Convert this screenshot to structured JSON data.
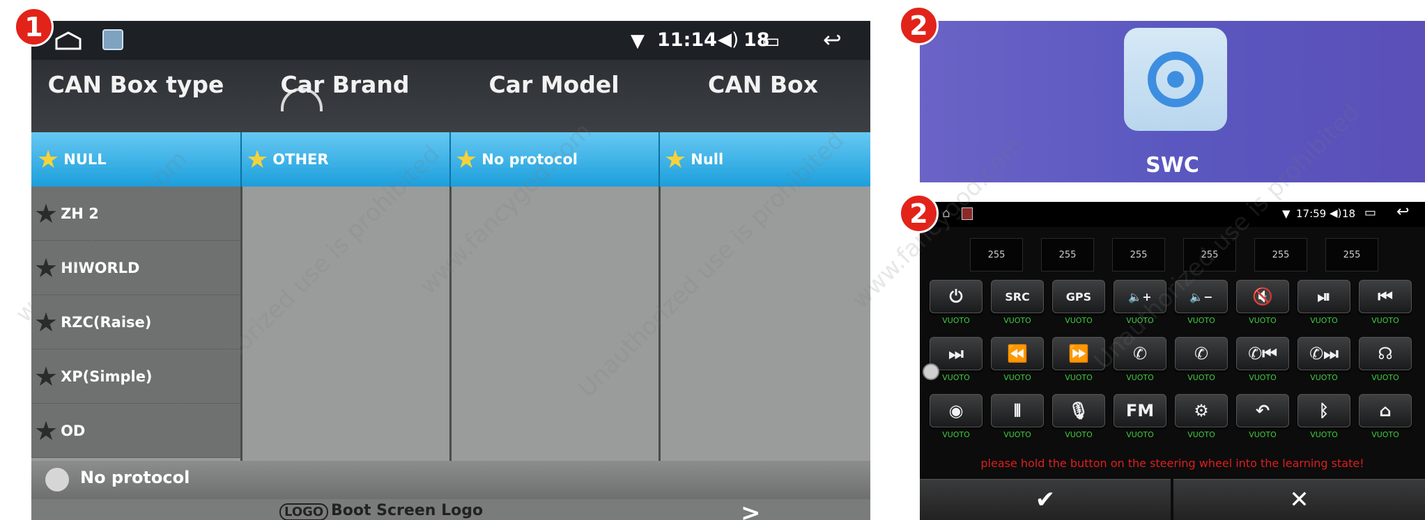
{
  "panel1": {
    "badge": "1",
    "status": {
      "time": "11:14",
      "volume": "18"
    },
    "columns": [
      "CAN Box type",
      "Car Brand",
      "Car Model",
      "CAN Box"
    ],
    "selected_row": [
      "NULL",
      "OTHER",
      "No protocol",
      "Null"
    ],
    "can_box_types": [
      "ZH 2",
      "HIWORLD",
      "RZC(Raise)",
      "XP(Simple)",
      "OD"
    ],
    "bottom_label": "No protocol",
    "boot_logo_badge": "LOGO",
    "boot_logo_label": "Boot Screen Logo",
    "boot_chevron": ">"
  },
  "panel2a": {
    "badge": "2",
    "app_label": "SWC"
  },
  "panel2b": {
    "badge": "2",
    "status": {
      "time": "17:59",
      "volume": "18"
    },
    "values": [
      "255",
      "255",
      "255",
      "255",
      "255",
      "255"
    ],
    "key_rows": [
      [
        {
          "glyph": "⏻",
          "icon": "power-icon",
          "label": "VUOTO"
        },
        {
          "glyph": "SRC",
          "icon": "src-icon",
          "label": "VUOTO"
        },
        {
          "glyph": "GPS",
          "icon": "gps-icon",
          "label": "VUOTO"
        },
        {
          "glyph": "🔈+",
          "icon": "volume-up-icon",
          "label": "VUOTO"
        },
        {
          "glyph": "🔈−",
          "icon": "volume-down-icon",
          "label": "VUOTO"
        },
        {
          "glyph": "🔇",
          "icon": "mute-icon",
          "label": "VUOTO"
        },
        {
          "glyph": "⏯",
          "icon": "play-pause-icon",
          "label": "VUOTO"
        },
        {
          "glyph": "⏮",
          "icon": "previous-icon",
          "label": "VUOTO"
        }
      ],
      [
        {
          "glyph": "⏭",
          "icon": "next-icon",
          "label": "VUOTO"
        },
        {
          "glyph": "⏪",
          "icon": "rewind-icon",
          "label": "VUOTO"
        },
        {
          "glyph": "⏩",
          "icon": "fast-forward-icon",
          "label": "VUOTO"
        },
        {
          "glyph": "✆",
          "icon": "phone-answer-icon",
          "label": "VUOTO"
        },
        {
          "glyph": "✆",
          "icon": "phone-hangup-icon",
          "label": "VUOTO"
        },
        {
          "glyph": "✆⏮",
          "icon": "phone-previous-icon",
          "label": "VUOTO"
        },
        {
          "glyph": "✆⏭",
          "icon": "phone-next-icon",
          "label": "VUOTO"
        },
        {
          "glyph": "☊",
          "icon": "voice-command-icon",
          "label": "VUOTO"
        }
      ],
      [
        {
          "glyph": "◉",
          "icon": "camera-icon",
          "label": "VUOTO"
        },
        {
          "glyph": "⫴",
          "icon": "aux-icon",
          "label": "VUOTO"
        },
        {
          "glyph": "🎙",
          "icon": "microphone-icon",
          "label": "VUOTO"
        },
        {
          "glyph": "FM",
          "icon": "fm-icon",
          "label": "VUOTO"
        },
        {
          "glyph": "⚙",
          "icon": "settings-icon",
          "label": "VUOTO"
        },
        {
          "glyph": "↶",
          "icon": "back-icon",
          "label": "VUOTO"
        },
        {
          "glyph": "ᛒ",
          "icon": "bluetooth-icon",
          "label": "VUOTO"
        },
        {
          "glyph": "⌂",
          "icon": "home-icon",
          "label": "VUOTO"
        }
      ]
    ],
    "message": "please hold the button on the steering wheel into the learning state!",
    "ok_glyph": "✔",
    "cancel_glyph": "✕"
  },
  "colors": {
    "selected_row": "#1c9fdc",
    "badge": "#e2231a",
    "key_label": "#3ecb3e",
    "message": "#e01e1e"
  }
}
